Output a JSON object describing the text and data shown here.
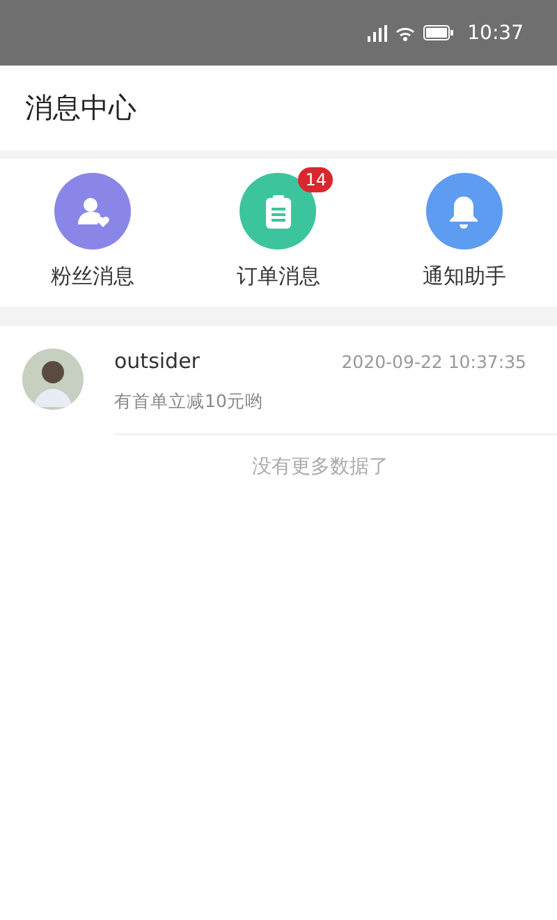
{
  "status_bar": {
    "time": "10:37"
  },
  "header": {
    "title": "消息中心"
  },
  "shortcuts": [
    {
      "kind": "fans",
      "label": "粉丝消息",
      "color": "#8a86e8"
    },
    {
      "kind": "orders",
      "label": "订单消息",
      "color": "#3cc59c",
      "badge": "14"
    },
    {
      "kind": "notify",
      "label": "通知助手",
      "color": "#5d9cf0"
    }
  ],
  "messages": [
    {
      "name": "outsider",
      "time": "2020-09-22 10:37:35",
      "preview": "有首单立减10元哟"
    }
  ],
  "footer_note": "没有更多数据了"
}
